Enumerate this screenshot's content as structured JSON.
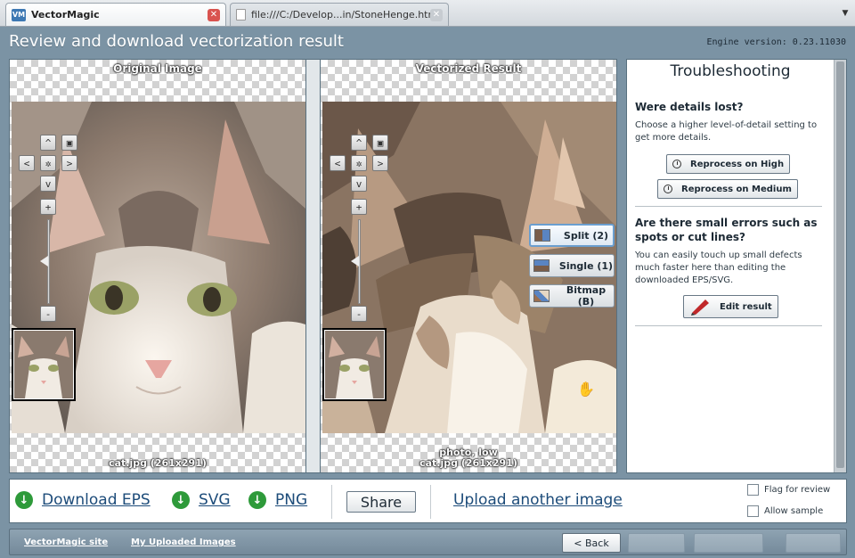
{
  "browser": {
    "tabs": [
      {
        "title": "VectorMagic",
        "favicon": "VM",
        "active": true
      },
      {
        "title": "file:///C:/Develop...in/StoneHenge.html",
        "active": false
      }
    ],
    "tab_menu_icon": "chevron-down-icon"
  },
  "header": {
    "title": "Review and download vectorization result",
    "engine_version": "Engine version: 0.23.11030"
  },
  "original": {
    "label": "Original Image",
    "caption": "cat.jpg  (261x291)"
  },
  "vectorized": {
    "label": "Vectorized Result",
    "caption_line1": "photo, low",
    "caption_line2": "cat.jpg  (261x291)"
  },
  "zoom_controls": {
    "up": "^",
    "left": "<",
    "right": ">",
    "down": "v",
    "plus": "+",
    "minus": "-",
    "slider_level": 0.5
  },
  "view_modes": [
    {
      "label": "Split (2)",
      "icon": "split-view-icon",
      "selected": true
    },
    {
      "label": "Single (1)",
      "icon": "single-view-icon",
      "selected": false
    },
    {
      "label": "Bitmap (B)",
      "icon": "bitmap-view-icon",
      "selected": false
    }
  ],
  "troubleshooting": {
    "title": "Troubleshooting",
    "section1": {
      "heading": "Were details lost?",
      "body": "Choose a higher level-of-detail setting to get more details.",
      "buttons": [
        "Reprocess on High",
        "Reprocess on Medium"
      ]
    },
    "section2": {
      "heading": "Are there small errors such as spots or cut lines?",
      "body": "You can easily touch up small defects much faster here than editing the downloaded EPS/SVG.",
      "button": "Edit result"
    }
  },
  "download": {
    "eps": "Download EPS",
    "svg": "SVG",
    "png": "PNG",
    "share": "Share",
    "upload": "Upload another image",
    "flag": "Flag for review",
    "sample": "Allow sample"
  },
  "footer": {
    "site_link": "VectorMagic site",
    "uploads_link": "My Uploaded Images",
    "back": "< Back",
    "next1": "",
    "next2": "",
    "next3": ""
  },
  "colors": {
    "background": "#7b93a4",
    "accent_link": "#1d4c7a",
    "download_green": "#2e9a3a"
  }
}
